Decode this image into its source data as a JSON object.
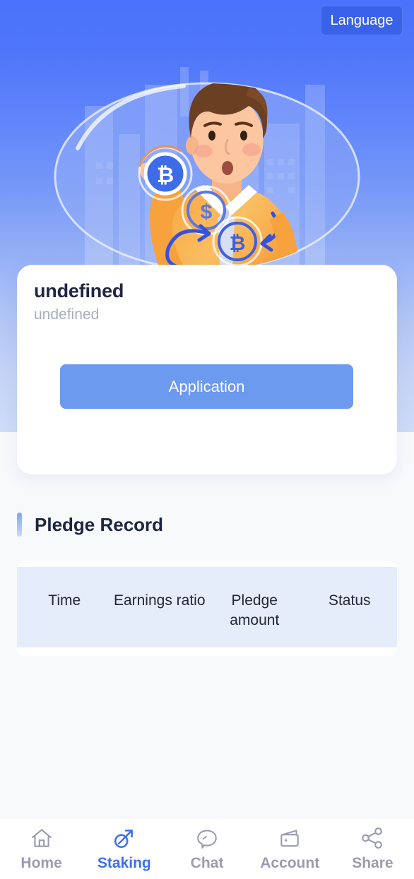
{
  "header": {
    "language_button": "Language"
  },
  "hero": {
    "illustration_name": "businessman-holding-bitcoin-illustration"
  },
  "card": {
    "title": "undefined",
    "subtitle": "undefined",
    "apply_button": "Application"
  },
  "pledge_record": {
    "section_title": "Pledge Record",
    "columns": [
      "Time",
      "Earnings ratio",
      "Pledge amount",
      "Status"
    ],
    "rows": []
  },
  "bottom_nav": {
    "items": [
      {
        "label": "Home",
        "icon": "home-icon",
        "active": false
      },
      {
        "label": "Staking",
        "icon": "shovel-icon",
        "active": true
      },
      {
        "label": "Chat",
        "icon": "chat-icon",
        "active": false
      },
      {
        "label": "Account",
        "icon": "wallet-icon",
        "active": false
      },
      {
        "label": "Share",
        "icon": "share-icon",
        "active": false
      }
    ]
  },
  "colors": {
    "hero_top": "#4A72FA",
    "hero_bottom": "#CFDBF7",
    "accent_blue": "#3B6FF5",
    "apply_button": "#6B9AEE",
    "table_header": "#E5ECFA",
    "title_text": "#1E2542",
    "muted_text": "#A9AFC0",
    "nav_inactive": "#9B9BB0",
    "page_bg": "#F8F9FB"
  }
}
